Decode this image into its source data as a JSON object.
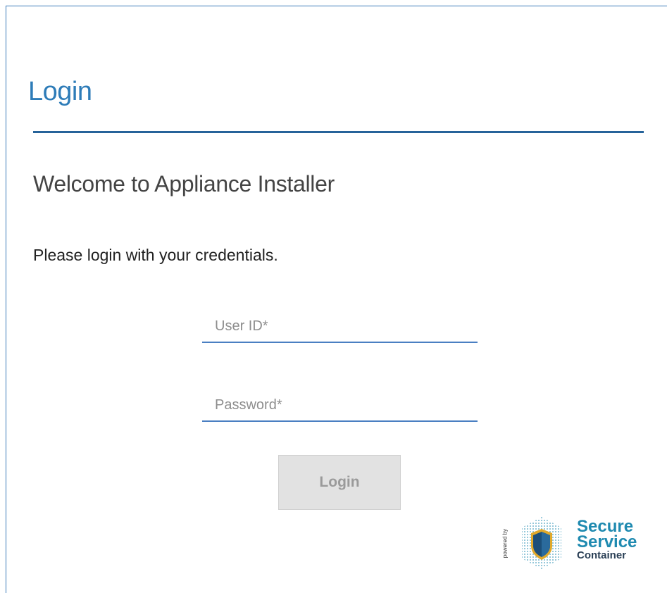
{
  "login_panel": {
    "title": "Login",
    "welcome": "Welcome to Appliance Installer",
    "instructions": "Please login with your credentials."
  },
  "form": {
    "user_id": {
      "placeholder": "User ID*",
      "value": ""
    },
    "password": {
      "placeholder": "Password*",
      "value": ""
    },
    "login_button_label": "Login"
  },
  "branding": {
    "powered_by": "powered by",
    "line1": "Secure",
    "line2": "Service",
    "line3": "Container",
    "shield_color": "#1c4f7a",
    "shield_accent": "#e0a92b",
    "text_color": "#1f8ab0"
  },
  "colors": {
    "accent": "#2e7cb8",
    "rule": "#26639a",
    "field_underline": "#4a7fc2",
    "button_bg": "#e2e2e2",
    "button_text": "#9a9a9a"
  }
}
